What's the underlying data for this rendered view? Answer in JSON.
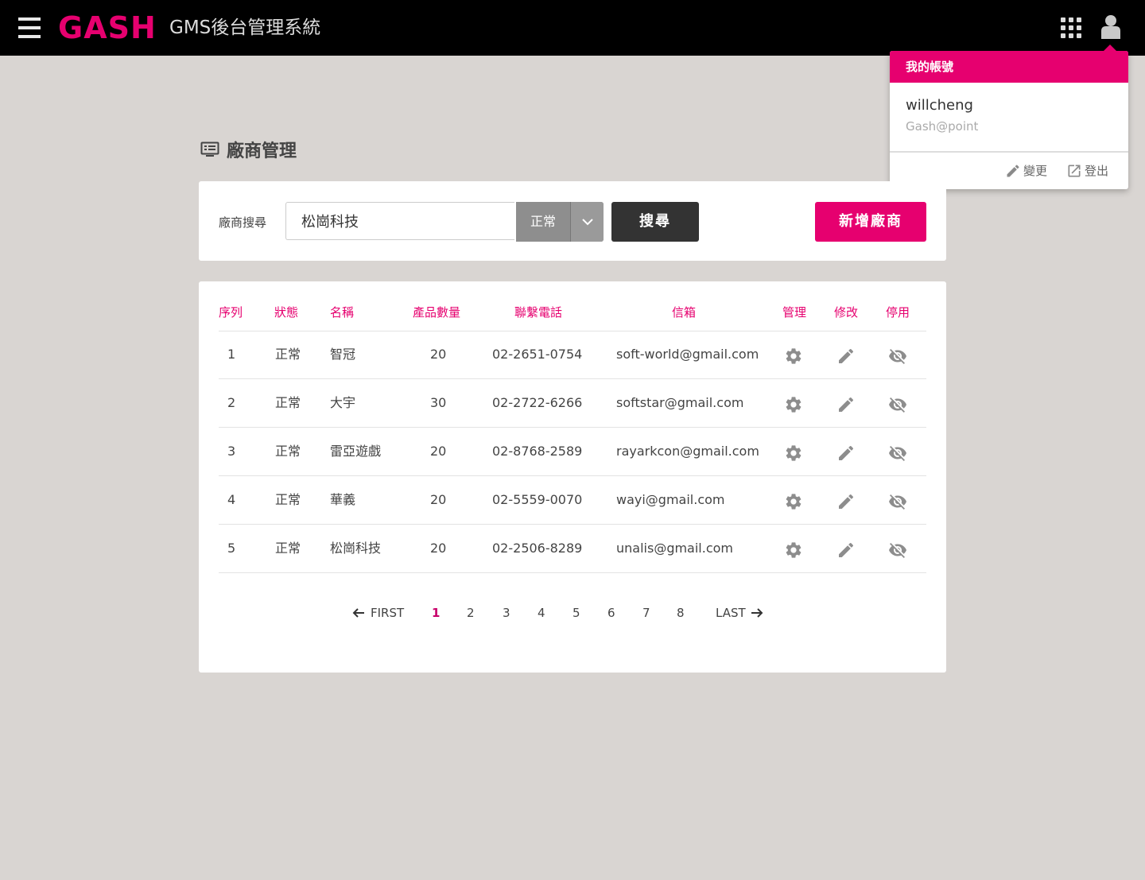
{
  "header": {
    "logo": "GASH",
    "app_title": "GMS後台管理系統"
  },
  "account_menu": {
    "title": "我的帳號",
    "username": "willcheng",
    "company": "Gash@point",
    "change_label": "變更",
    "logout_label": "登出"
  },
  "page": {
    "title": "廠商管理"
  },
  "search": {
    "label": "廠商搜尋",
    "value": "松崗科技",
    "status_selected": "正常",
    "search_button": "搜尋",
    "add_button": "新增廠商"
  },
  "table": {
    "columns": [
      "序列",
      "狀態",
      "名稱",
      "產品數量",
      "聯繫電話",
      "信箱",
      "管理",
      "修改",
      "停用"
    ],
    "rows": [
      {
        "seq": "1",
        "status": "正常",
        "name": "智冠",
        "qty": "20",
        "phone": "02-2651-0754",
        "email": "soft-world@gmail.com"
      },
      {
        "seq": "2",
        "status": "正常",
        "name": "大宇",
        "qty": "30",
        "phone": "02-2722-6266",
        "email": "softstar@gmail.com"
      },
      {
        "seq": "3",
        "status": "正常",
        "name": "雷亞遊戲",
        "qty": "20",
        "phone": "02-8768-2589",
        "email": "rayarkcon@gmail.com"
      },
      {
        "seq": "4",
        "status": "正常",
        "name": "華義",
        "qty": "20",
        "phone": "02-5559-0070",
        "email": "wayi@gmail.com"
      },
      {
        "seq": "5",
        "status": "正常",
        "name": "松崗科技",
        "qty": "20",
        "phone": "02-2506-8289",
        "email": "unalis@gmail.com"
      }
    ]
  },
  "pagination": {
    "first": "FIRST",
    "last": "LAST",
    "pages": [
      "1",
      "2",
      "3",
      "4",
      "5",
      "6",
      "7",
      "8"
    ],
    "current": "1"
  },
  "colors": {
    "brand": "#e6006f",
    "topbar": "#000000",
    "background": "#d9d5d2"
  }
}
